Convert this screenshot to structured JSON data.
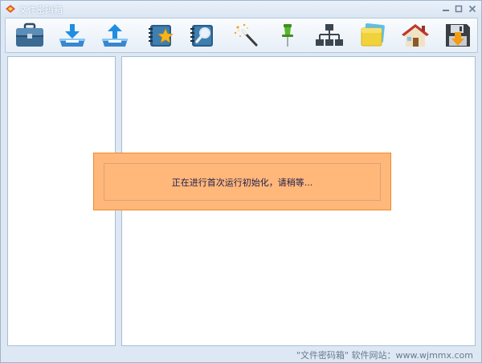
{
  "window": {
    "title": "文件密码箱"
  },
  "toolbar": {
    "items": [
      {
        "icon": "toolbox-icon"
      },
      {
        "icon": "download-tray-icon"
      },
      {
        "icon": "upload-tray-icon"
      },
      {
        "icon": "favorites-book-icon"
      },
      {
        "icon": "search-book-icon"
      },
      {
        "icon": "magic-wand-icon"
      },
      {
        "icon": "pushpin-icon"
      },
      {
        "icon": "network-tree-icon"
      },
      {
        "icon": "cards-icon"
      },
      {
        "icon": "home-icon"
      },
      {
        "icon": "save-disk-icon"
      }
    ]
  },
  "modal": {
    "message": "正在进行首次运行初始化，请稍等..."
  },
  "status": {
    "text": "\"文件密码箱\" 软件网站：www.wjmmx.com"
  },
  "colors": {
    "modal_fill": "#ffb77a",
    "modal_border": "#f08a2c",
    "window_bg": "#dde8f4"
  }
}
